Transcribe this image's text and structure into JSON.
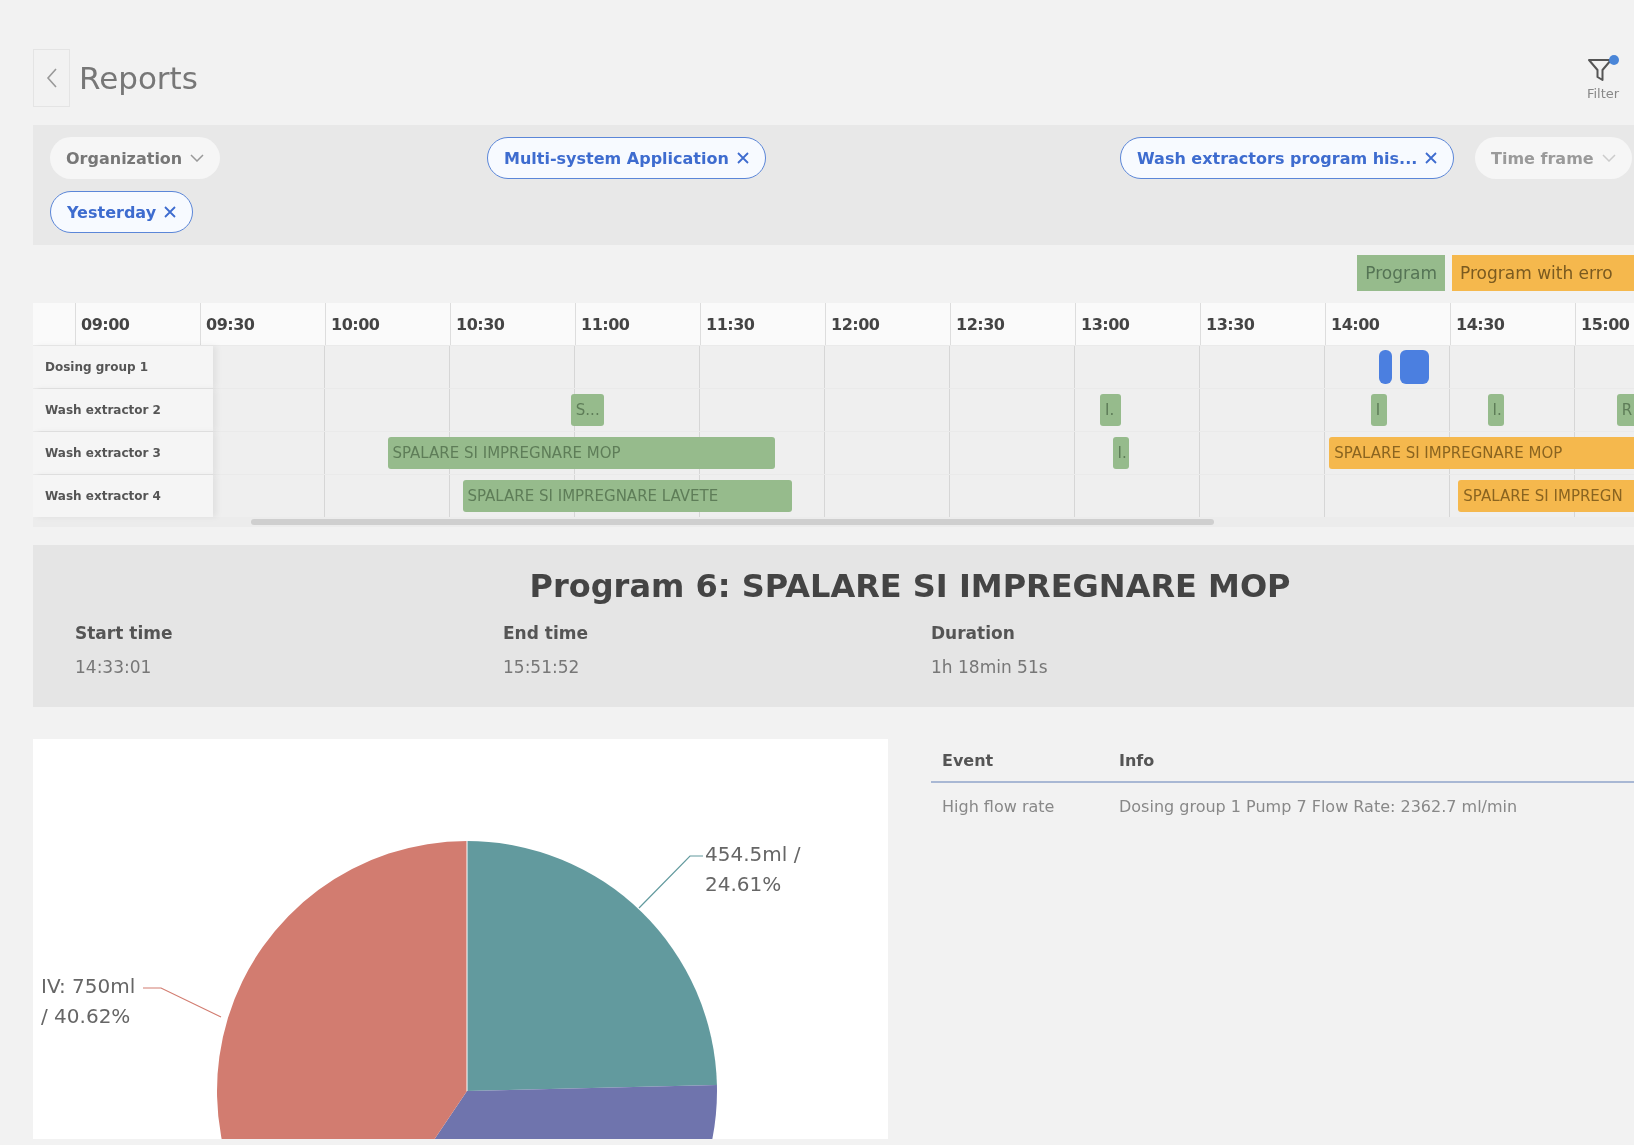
{
  "header": {
    "title": "Reports",
    "filter_label": "Filter"
  },
  "filters": [
    {
      "kind": "dropdown",
      "label": "Organization",
      "disabled": false
    },
    {
      "kind": "tag",
      "label": "Multi-system Application"
    },
    {
      "kind": "tag",
      "label": "Wash extractors program his..."
    },
    {
      "kind": "dropdown",
      "label": "Time frame",
      "disabled": true
    },
    {
      "kind": "tag",
      "label": "Yesterday"
    }
  ],
  "legend": [
    {
      "kind": "program",
      "label": "Program"
    },
    {
      "kind": "error",
      "label": "Program with erro"
    }
  ],
  "timeline": {
    "times": [
      "09:00",
      "09:30",
      "10:00",
      "10:30",
      "11:00",
      "11:30",
      "12:00",
      "12:30",
      "13:00",
      "13:30",
      "14:00",
      "14:30",
      "15:00"
    ],
    "rows": [
      {
        "label": "Dosing group 1",
        "bars": [
          {
            "kind": "dosing"
          },
          {
            "kind": "dosing"
          }
        ]
      },
      {
        "label": "Wash extractor 2",
        "bars": [
          {
            "kind": "program",
            "text": "S..."
          },
          {
            "kind": "program",
            "text": "I."
          },
          {
            "kind": "program",
            "text": "I"
          },
          {
            "kind": "program",
            "text": "I."
          },
          {
            "kind": "program",
            "text": "R"
          }
        ]
      },
      {
        "label": "Wash extractor 3",
        "bars": [
          {
            "kind": "program",
            "text": "SPALARE SI IMPREGNARE MOP"
          },
          {
            "kind": "program",
            "text": "I."
          },
          {
            "kind": "error",
            "text": "SPALARE SI IMPREGNARE MOP"
          }
        ]
      },
      {
        "label": "Wash extractor 4",
        "bars": [
          {
            "kind": "program",
            "text": "SPALARE SI IMPREGNARE LAVETE"
          },
          {
            "kind": "error",
            "text": "SPALARE SI IMPREGN"
          }
        ]
      }
    ]
  },
  "program": {
    "title": "Program 6: SPALARE SI IMPREGNARE MOP",
    "fields": [
      {
        "label": "Start time",
        "value": "14:33:01"
      },
      {
        "label": "End time",
        "value": "15:51:52"
      },
      {
        "label": "Duration",
        "value": "1h 18min 51s"
      }
    ]
  },
  "pie_labels": [
    {
      "lines": [
        "454.5ml /",
        "24.61%"
      ]
    },
    {
      "lines": [
        "IV: 750ml",
        "/ 40.62%"
      ]
    }
  ],
  "events": {
    "columns": [
      "Event",
      "Info"
    ],
    "rows": [
      [
        "High flow rate",
        "Dosing group 1 Pump 7 Flow Rate: 2362.7 ml/min"
      ]
    ]
  }
}
